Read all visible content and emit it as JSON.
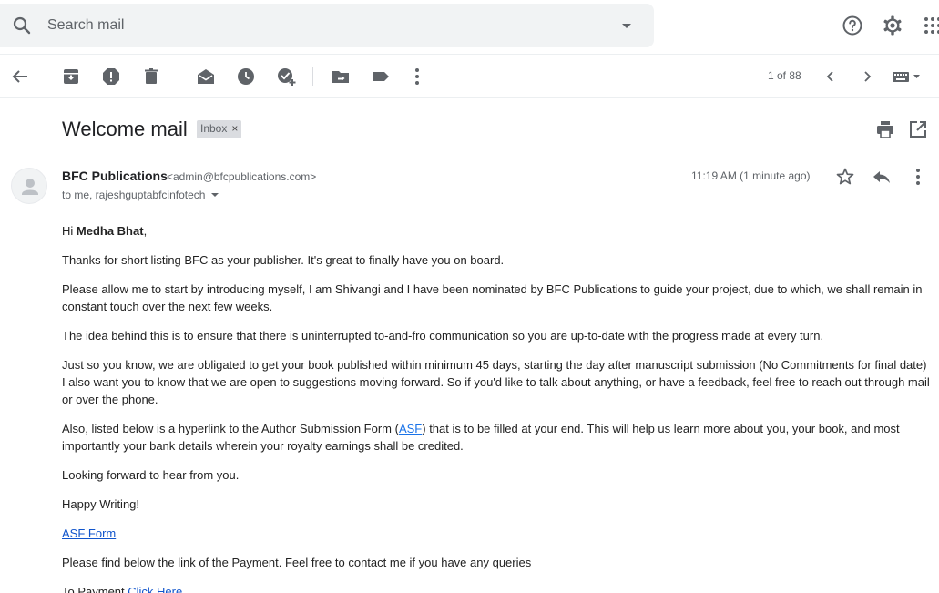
{
  "search": {
    "placeholder": "Search mail"
  },
  "toolbar": {
    "pager": "1 of 88"
  },
  "email": {
    "subject": "Welcome mail",
    "label": "Inbox",
    "label_close": "×",
    "sender_name": "BFC Publications",
    "sender_email": "<admin@bfcpublications.com>",
    "to": "to me, rajeshguptabfcinfotech",
    "time": "11:19 AM (1 minute ago)"
  },
  "body": {
    "greeting_prefix": "Hi ",
    "greeting_name": "Medha Bhat",
    "greeting_suffix": ",",
    "p1": "Thanks for short listing BFC as your publisher. It's great to finally have you on board.",
    "p2": "Please allow me to start by introducing myself, I am Shivangi and I have been nominated by BFC Publications to guide your project, due to which, we shall remain in constant touch over the next few weeks.",
    "p3": "The idea behind this is to ensure that there is uninterrupted to-and-fro communication so you are up-to-date with the progress made at every turn.",
    "p4a": "Just so you know, we are obligated to get your book published within minimum 45 days, starting the day after manuscript submission (No Commitments for final date)",
    "p4b": "I also want you to know that we are open to suggestions moving forward. So if you'd like to talk about anything, or have a feedback, feel free to reach out through mail or over the phone.",
    "p5_prefix": "Also, listed below is a hyperlink to the Author Submission Form (",
    "p5_link": "ASF",
    "p5_suffix": ") that is to be filled at your end. This will help us learn more about you, your book, and most importantly your bank details wherein your royalty earnings shall be credited.",
    "p6": "Looking forward to hear from you.",
    "p7": "Happy Writing!",
    "asf_form_link": "ASF Form",
    "p8": "Please find below the link of the Payment. Feel free to contact me if you have any queries",
    "payment_prefix": "To Payment ",
    "payment_link": "Click Here"
  },
  "icons": {
    "search": "search-icon",
    "dropdown": "dropdown-icon",
    "help": "help-icon",
    "settings": "gear-icon",
    "apps": "apps-icon"
  }
}
